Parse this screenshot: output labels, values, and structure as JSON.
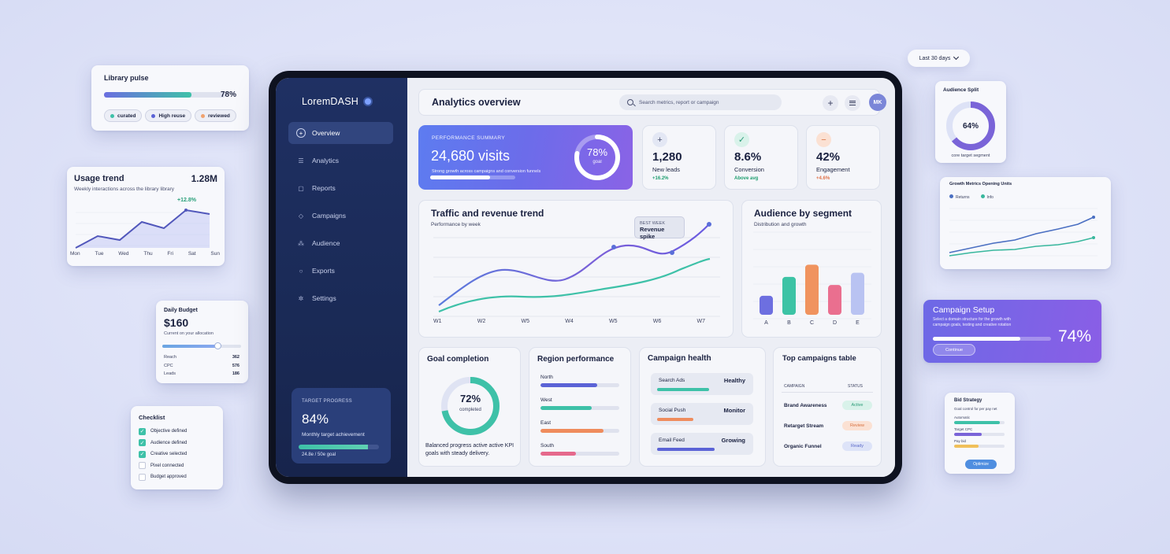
{
  "library_pulse": {
    "title": "Library pulse",
    "percent": "78%",
    "progress": 0.78,
    "tags": [
      "curated",
      "High reuse",
      "reviewed"
    ]
  },
  "usage_trend": {
    "title": "Usage trend",
    "value": "1.28M",
    "subtitle": "Weekly interactions across the library library",
    "delta": "+12.8%",
    "days": [
      "Mon",
      "Tue",
      "Wed",
      "Thu",
      "Fri",
      "Sat",
      "Sun"
    ]
  },
  "daily_budget": {
    "title": "Daily Budget",
    "value": "$160",
    "subtitle": "Current on your allocation",
    "slider": 0.78,
    "rows": [
      {
        "label": "Reach",
        "value": "362"
      },
      {
        "label": "CPC",
        "value": "576"
      },
      {
        "label": "Leads",
        "value": "186"
      }
    ]
  },
  "checklist": {
    "title": "Checklist",
    "items": [
      {
        "label": "Objective defined",
        "checked": true
      },
      {
        "label": "Audience defined",
        "checked": true
      },
      {
        "label": "Creative selected",
        "checked": true
      },
      {
        "label": "Pixel connected",
        "checked": false
      },
      {
        "label": "Budget approved",
        "checked": false
      }
    ]
  },
  "sidebar": {
    "brand": "LoremDASH",
    "items": [
      {
        "label": "Overview",
        "icon": "plus-icon"
      },
      {
        "label": "Analytics",
        "icon": "list-icon"
      },
      {
        "label": "Reports",
        "icon": "square-icon"
      },
      {
        "label": "Campaigns",
        "icon": "diamond-icon"
      },
      {
        "label": "Audience",
        "icon": "people-icon"
      },
      {
        "label": "Exports",
        "icon": "circle-icon"
      },
      {
        "label": "Settings",
        "icon": "gear-icon"
      }
    ],
    "target": {
      "label": "TARGET PROGRESS",
      "value": "84%",
      "caption": "Monthly target achievement",
      "progress": 0.84,
      "footer": "24.8e / 50e goal"
    }
  },
  "header": {
    "title": "Analytics overview",
    "search_placeholder": "Search metrics, report or campaign",
    "avatar": "MK"
  },
  "summary": {
    "label": "PERFORMANCE SUMMARY",
    "visits": "24,680 visits",
    "caption": "Strong growth across campaigns and conversion funnels",
    "ring_value": "78%",
    "ring_label": "goal",
    "ring_progress": 0.78,
    "bar_progress": 0.7
  },
  "kpis": [
    {
      "value": "1,280",
      "label": "New leads",
      "delta": "+16.2%",
      "icon": "plus-icon",
      "delta_color": "#1e9e6f"
    },
    {
      "value": "8.6%",
      "label": "Conversion",
      "delta": "Above avg",
      "icon": "check-icon",
      "delta_color": "#1e9e6f"
    },
    {
      "value": "42%",
      "label": "Engagement",
      "delta": "+4.6%",
      "icon": "minus-icon",
      "delta_color": "#e0734a"
    }
  ],
  "traffic": {
    "title": "Traffic and revenue trend",
    "subtitle": "Performance by week",
    "callout_label": "BEST WEEK",
    "callout_value": "Revenue spike",
    "weeks": [
      "W1",
      "W2",
      "W5",
      "W4",
      "W5",
      "W6",
      "W7"
    ]
  },
  "audience": {
    "title": "Audience by segment",
    "subtitle": "Distribution and growth",
    "categories": [
      "A",
      "B",
      "C",
      "D",
      "E"
    ],
    "values": [
      0.28,
      0.56,
      0.74,
      0.44,
      0.62
    ],
    "colors": [
      "#6d6fe0",
      "#3cc3a5",
      "#f0935e",
      "#ea6f8f",
      "#b9c3f2"
    ]
  },
  "goal": {
    "title": "Goal completion",
    "value": "72%",
    "label": "completed",
    "progress": 0.72,
    "caption": "Balanced progress active active KPI goals with steady delivery."
  },
  "region": {
    "title": "Region performance",
    "rows": [
      {
        "label": "North",
        "progress": 0.72,
        "color": "#5b63d6"
      },
      {
        "label": "West",
        "progress": 0.65,
        "color": "#3ec1a8"
      },
      {
        "label": "East",
        "progress": 0.8,
        "color": "#ef8c5d"
      },
      {
        "label": "South",
        "progress": 0.45,
        "color": "#e5698c"
      }
    ]
  },
  "health": {
    "title": "Campaign health",
    "rows": [
      {
        "name": "Search Ads",
        "status": "Healthy",
        "progress": 0.6,
        "color": "#3ec1a8"
      },
      {
        "name": "Social Push",
        "status": "Monitor",
        "progress": 0.42,
        "color": "#ef8c5d"
      },
      {
        "name": "Email Feed",
        "status": "Growing",
        "progress": 0.66,
        "color": "#5b63d6"
      }
    ]
  },
  "top_campaigns": {
    "title": "Top campaigns table",
    "col_campaign": "CAMPAIGN",
    "col_status": "STATUS",
    "rows": [
      {
        "name": "Brand Awareness",
        "status": "Active",
        "bg": "#d9f2ea",
        "fg": "#2a9a77"
      },
      {
        "name": "Retarget Stream",
        "status": "Review",
        "bg": "#fbe1d3",
        "fg": "#d7703f"
      },
      {
        "name": "Organic Funnel",
        "status": "Ready",
        "bg": "#dde3f8",
        "fg": "#5a68c8"
      }
    ]
  },
  "range_selector": {
    "label": "Last 30 days"
  },
  "audience_split": {
    "title": "Audience Split",
    "value": "64%",
    "progress": 0.64,
    "caption": "core target segment"
  },
  "growth": {
    "title": "Growth Metrics Opening Units",
    "legend": [
      "Returns",
      "Info"
    ],
    "series_colors": [
      "#4a6fc2",
      "#38b79d"
    ]
  },
  "campaign_setup": {
    "title": "Campaign Setup",
    "desc": "Select a domain structure for the growth with campaign goals, testing and creative rotation",
    "percent": "74%",
    "progress": 0.74,
    "button": "Continue"
  },
  "bid_strategy": {
    "title": "Bid Strategy",
    "subtitle": "Goal control for per pay net",
    "rows": [
      {
        "label": "Automatic",
        "progress": 0.9,
        "color": "#3ec1a8"
      },
      {
        "label": "Target CPC",
        "progress": 0.55,
        "color": "#7a64d8"
      },
      {
        "label": "Pay bid",
        "progress": 0.48,
        "color": "#f0c05a"
      }
    ],
    "button": "Optimize"
  }
}
